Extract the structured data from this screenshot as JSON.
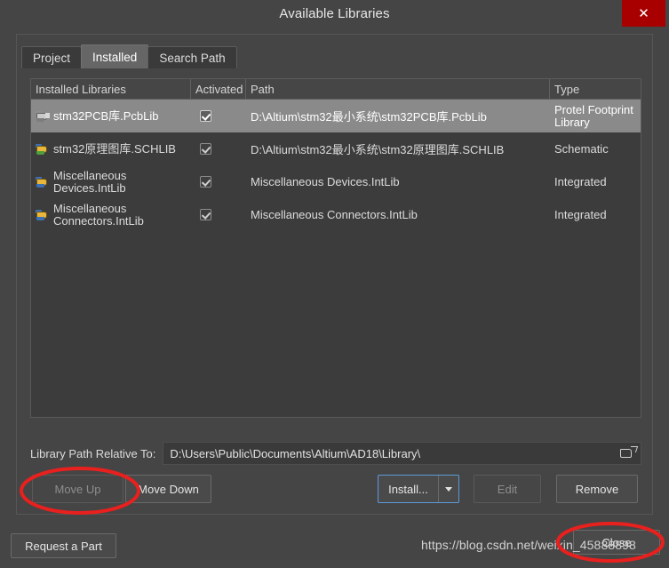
{
  "window": {
    "title": "Available Libraries",
    "close_icon": "close-x-icon"
  },
  "tabs": [
    {
      "label": "Project",
      "active": false
    },
    {
      "label": "Installed",
      "active": true
    },
    {
      "label": "Search Path",
      "active": false
    }
  ],
  "table": {
    "columns": [
      {
        "key": "name",
        "label": "Installed Libraries"
      },
      {
        "key": "activated",
        "label": "Activated"
      },
      {
        "key": "path",
        "label": "Path"
      },
      {
        "key": "type",
        "label": "Type"
      }
    ],
    "rows": [
      {
        "name": "stm32PCB库.PcbLib",
        "activated": true,
        "path": "D:\\Altium\\stm32最小系统\\stm32PCB库.PcbLib",
        "type": "Protel Footprint Library",
        "selected": true,
        "icon": "pcb-library-icon"
      },
      {
        "name": "stm32原理图库.SCHLIB",
        "activated": true,
        "path": "D:\\Altium\\stm32最小系统\\stm32原理图库.SCHLIB",
        "type": "Schematic",
        "selected": false,
        "icon": "schematic-library-icon"
      },
      {
        "name": "Miscellaneous Devices.IntLib",
        "activated": true,
        "path": "Miscellaneous Devices.IntLib",
        "type": "Integrated",
        "selected": false,
        "icon": "integrated-library-icon"
      },
      {
        "name": "Miscellaneous Connectors.IntLib",
        "activated": true,
        "path": "Miscellaneous Connectors.IntLib",
        "type": "Integrated",
        "selected": false,
        "icon": "integrated-library-icon"
      }
    ]
  },
  "path_field": {
    "label": "Library Path Relative To:",
    "value": "D:\\Users\\Public\\Documents\\Altium\\AD18\\Library\\",
    "browse_icon": "open-folder-icon"
  },
  "buttons": {
    "move_up": {
      "label": "Move Up",
      "enabled": false
    },
    "move_down": {
      "label": "Move Down",
      "enabled": true
    },
    "install": {
      "label": "Install...",
      "enabled": true,
      "dropdown_icon": "chevron-down-icon"
    },
    "edit": {
      "label": "Edit",
      "enabled": false
    },
    "remove": {
      "label": "Remove",
      "enabled": true
    },
    "request_part": {
      "label": "Request a Part",
      "enabled": true
    },
    "close": {
      "label": "Close",
      "enabled": true
    }
  },
  "watermark": "https://blog.csdn.net/weixin_45888898",
  "colors": {
    "dialog_bg": "#454545",
    "list_bg": "#3c3c3c",
    "selected_row": "#8a8a8a",
    "close_button_red": "#a80000",
    "focus_border_blue": "#5c9bd6",
    "annotation_red": "#e8201e",
    "text": "#e0e0e0"
  }
}
